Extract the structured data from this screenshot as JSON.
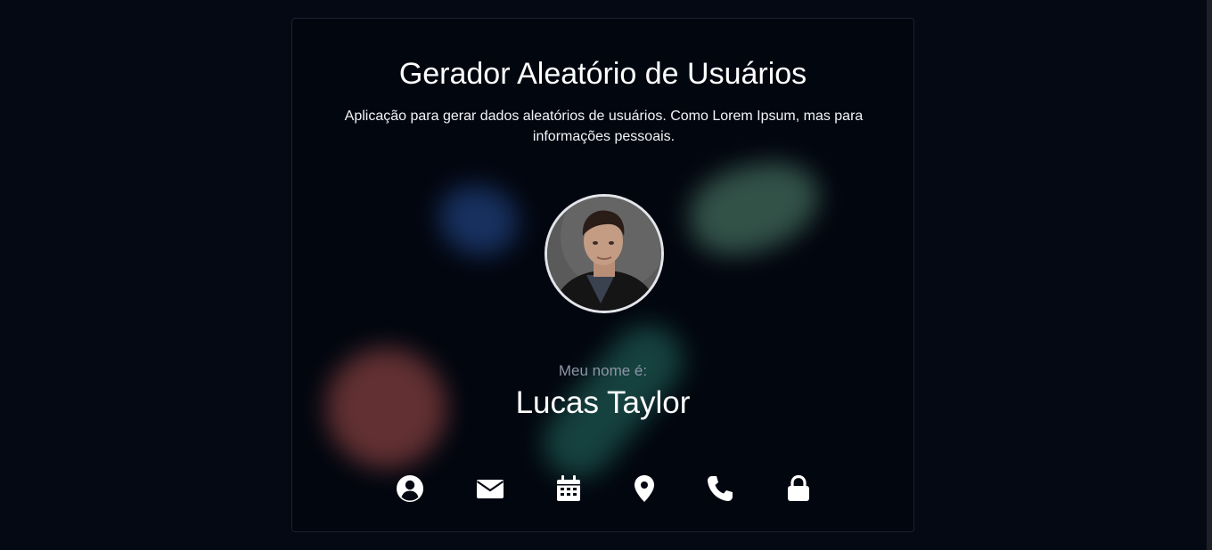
{
  "card": {
    "title": "Gerador Aleatório de Usuários",
    "subtitle": "Aplicação para gerar dados aleatórios de usuários. Como Lorem Ipsum, mas para informações pessoais."
  },
  "user": {
    "label": "Meu nome é:",
    "value": "Lucas Taylor"
  },
  "icons": [
    {
      "name": "user-circle-icon"
    },
    {
      "name": "envelope-icon"
    },
    {
      "name": "calendar-icon"
    },
    {
      "name": "map-marker-icon"
    },
    {
      "name": "phone-icon"
    },
    {
      "name": "lock-icon"
    }
  ],
  "colors": {
    "background": "#050913",
    "card": "#02060f",
    "label": "#8d96a7",
    "text": "#ffffff"
  }
}
